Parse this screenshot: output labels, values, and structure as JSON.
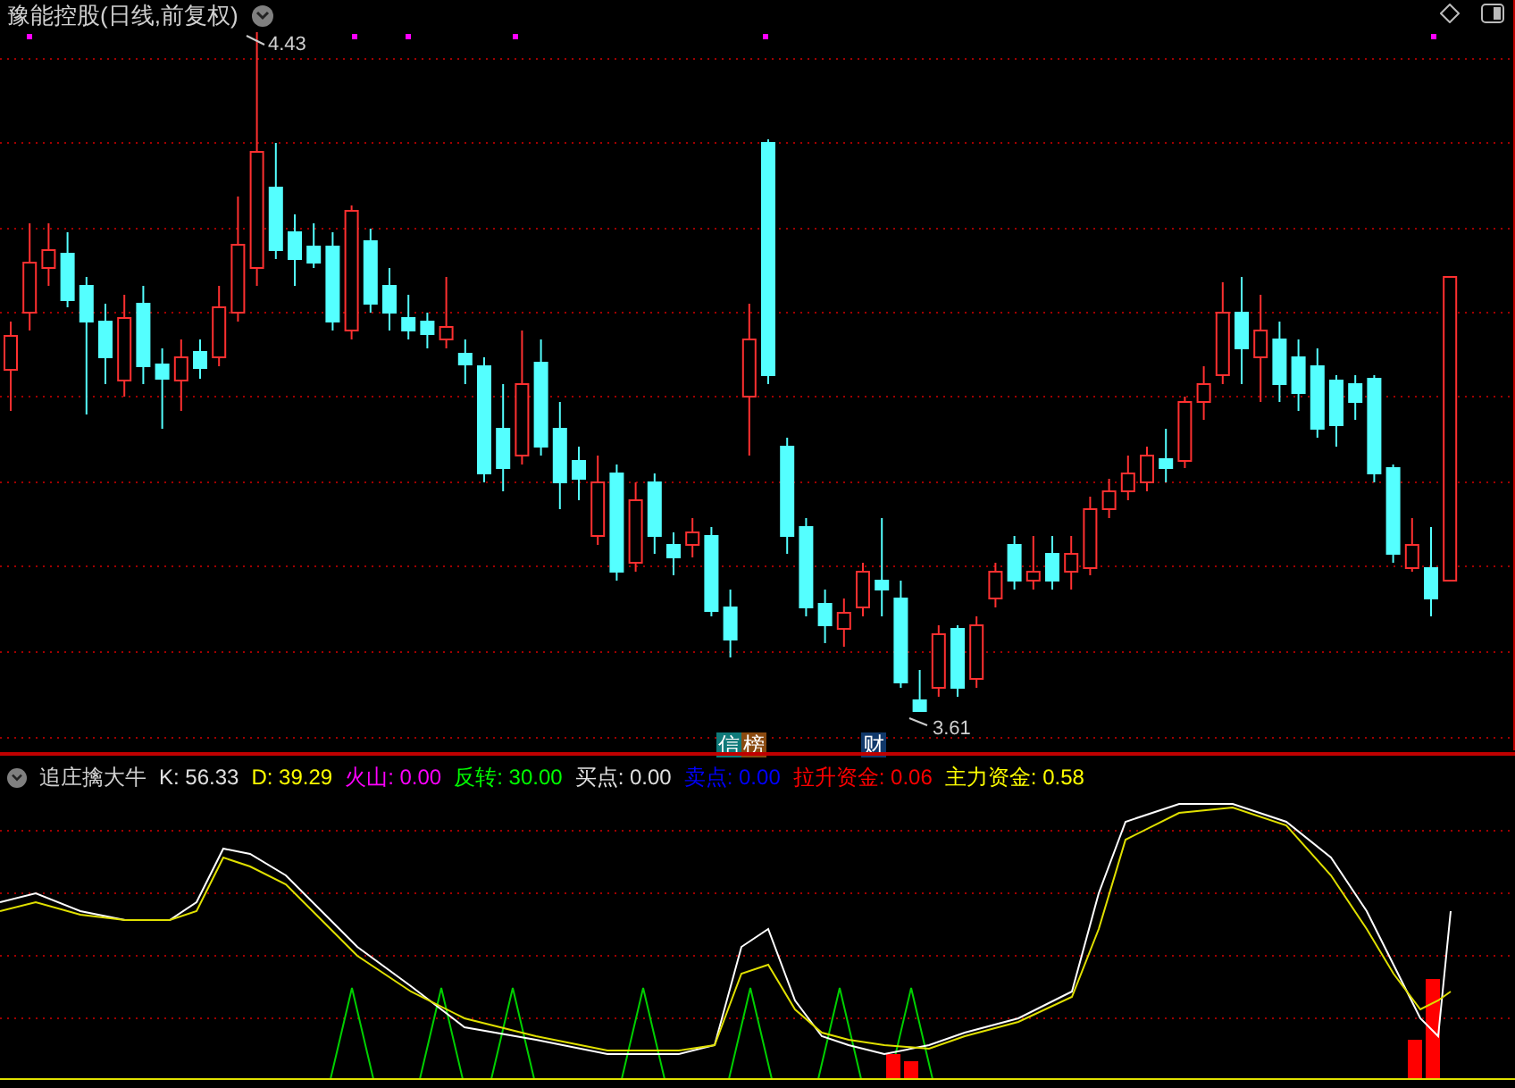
{
  "chart": {
    "title": "豫能控股(日线,前复权)",
    "high_label": "4.43",
    "low_label": "3.61"
  },
  "badges": [
    {
      "text": "信",
      "color": "#0f7a7a"
    },
    {
      "text": "榜",
      "color": "#8a4a10"
    },
    {
      "text": "财",
      "color": "#10386a"
    }
  ],
  "indicator": {
    "name": "追庄擒大牛",
    "readings": [
      {
        "text": "K: 56.33",
        "color": "#e0e0e0"
      },
      {
        "text": "D: 39.29",
        "color": "#ffff00"
      },
      {
        "text": "火山: 0.00",
        "color": "#ff00ff"
      },
      {
        "text": "反转: 30.00",
        "color": "#00ff00"
      },
      {
        "text": "买点: 0.00",
        "color": "#e0e0e0"
      },
      {
        "text": "卖点: 0.00",
        "color": "#0000ff"
      },
      {
        "text": "拉升资金: 0.06",
        "color": "#ff0000"
      },
      {
        "text": "主力资金: 0.58",
        "color": "#ffff00"
      }
    ]
  }
}
